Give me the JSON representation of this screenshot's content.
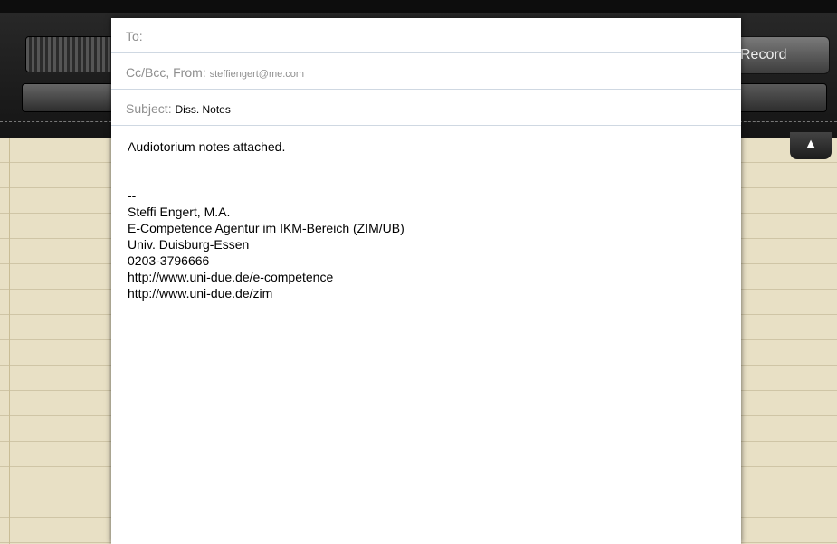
{
  "background_app": {
    "record_label": "Record",
    "toggle_arrow": "▲"
  },
  "compose": {
    "to_label": "To:",
    "ccbcc_label": "Cc/Bcc, From:",
    "from_value": "steffiengert@me.com",
    "subject_label": "Subject:",
    "subject_value": "Diss. Notes",
    "body": {
      "greeting": "Audiotorium notes attached.",
      "separator": "--",
      "sig_name": "Steffi Engert, M.A.",
      "sig_title": "E-Competence Agentur im IKM-Bereich (ZIM/UB)",
      "sig_org": "Univ. Duisburg-Essen",
      "sig_phone": "0203-3796666",
      "sig_url1": "http://www.uni-due.de/e-competence",
      "sig_url2": "http://www.uni-due.de/zim"
    }
  }
}
